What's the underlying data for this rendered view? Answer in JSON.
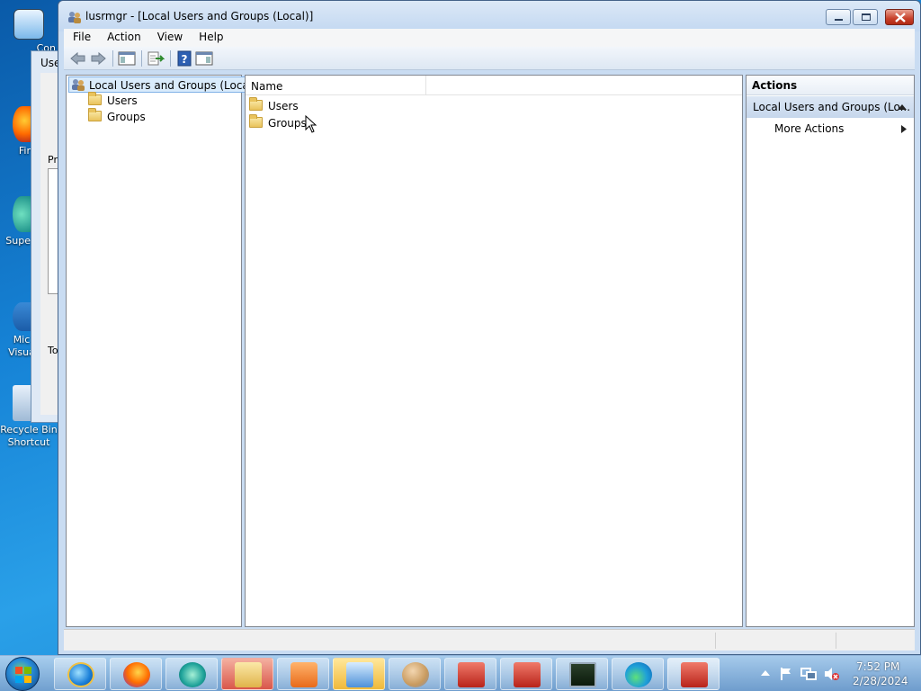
{
  "desktop": {
    "icons": [
      {
        "label": "Con"
      },
      {
        "label": "Fir"
      },
      {
        "label": "Supe"
      },
      {
        "label": "Mic Visua"
      },
      {
        "label": "Recycle Bin Shortcut"
      }
    ],
    "background_window": {
      "title_fragment": "Use",
      "label1": "Pro",
      "label2": "To"
    }
  },
  "window": {
    "title": "lusrmgr - [Local Users and Groups (Local)]",
    "menu": [
      "File",
      "Action",
      "View",
      "Help"
    ],
    "toolbar_icons": [
      "back-arrow-icon",
      "forward-arrow-icon",
      "show-hide-console-tree-icon",
      "export-list-icon",
      "help-icon",
      "show-hide-action-pane-icon"
    ]
  },
  "tree": {
    "root": "Local Users and Groups (Local)",
    "children": [
      "Users",
      "Groups"
    ]
  },
  "list": {
    "column_name": "Name",
    "items": [
      "Users",
      "Groups"
    ]
  },
  "actions": {
    "title": "Actions",
    "section": "Local Users and Groups (Lo...",
    "more": "More Actions"
  },
  "taskbar": {
    "time": "7:52 PM",
    "date": "2/28/2024"
  },
  "colors": {
    "accent": "#3399ff",
    "selection": "#cce8ff",
    "close_red": "#c7402a"
  }
}
